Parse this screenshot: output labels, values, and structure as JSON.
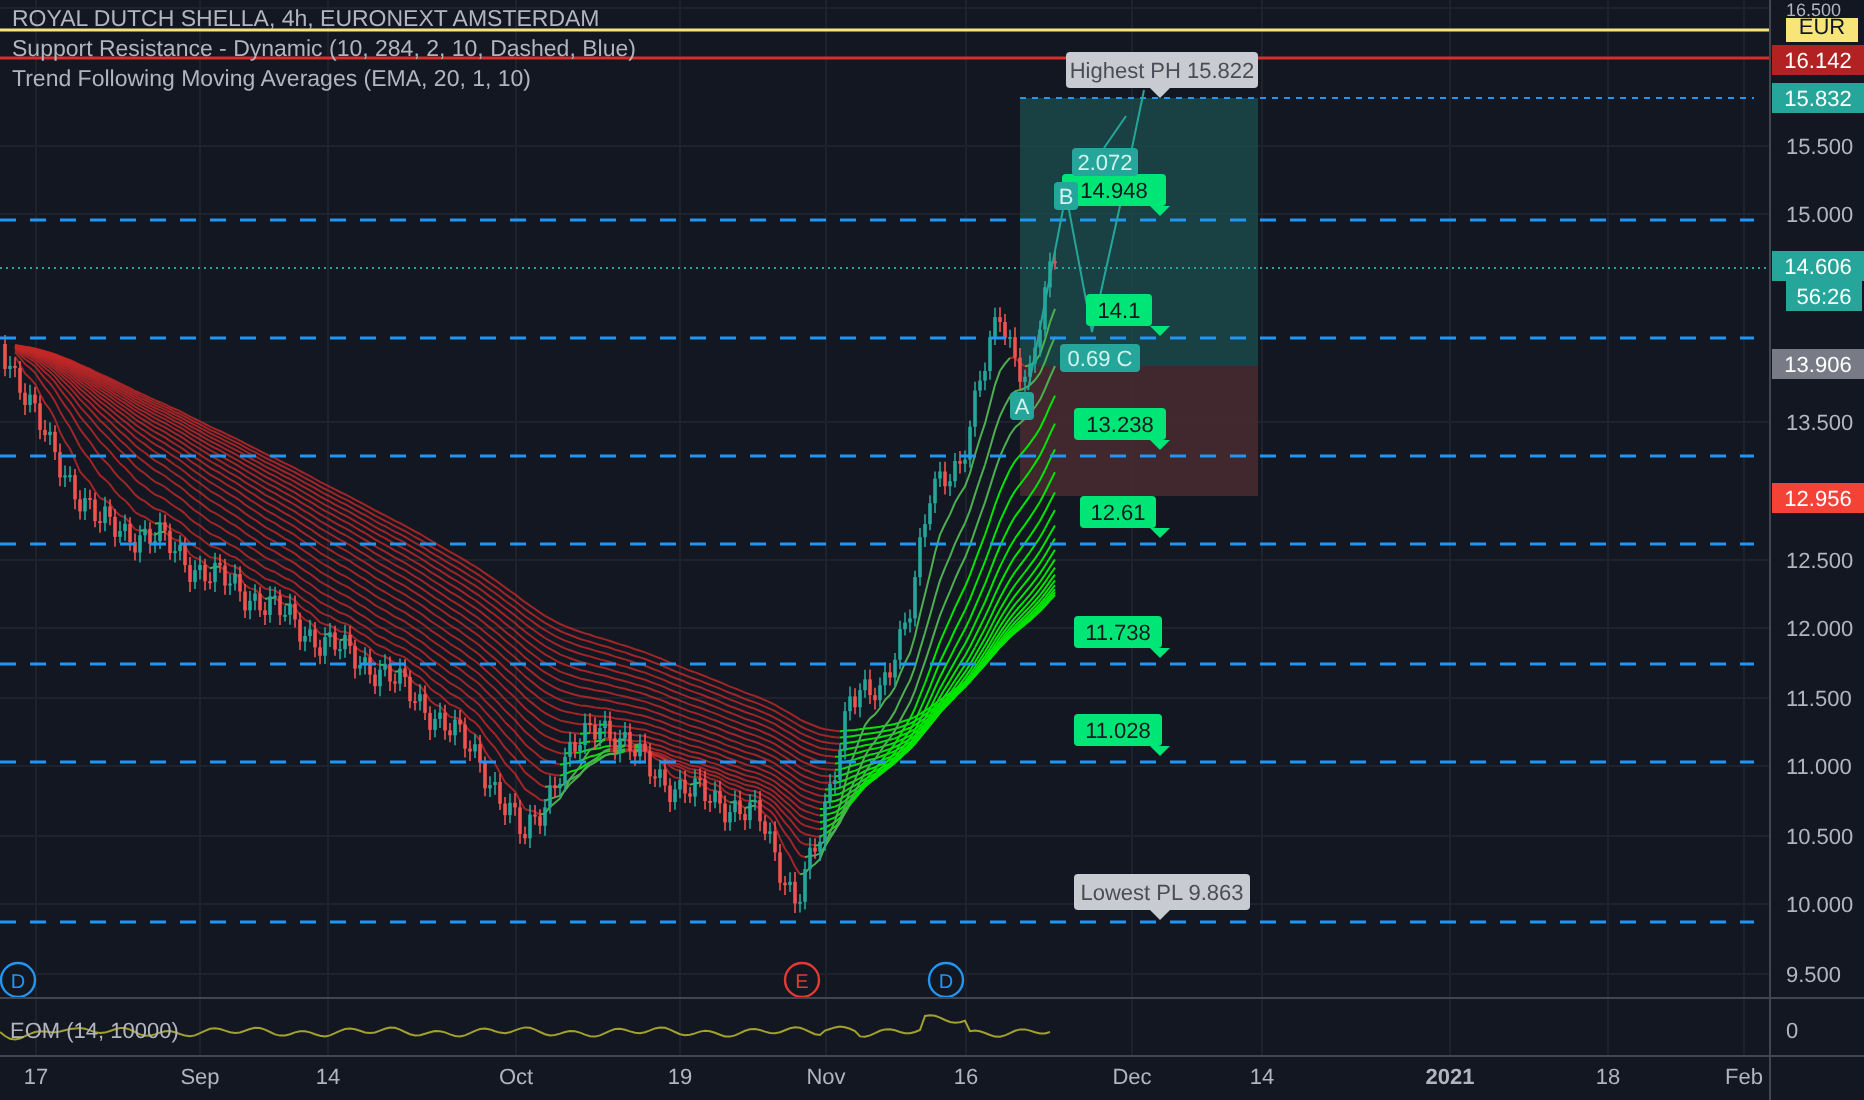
{
  "legend": [
    "ROYAL DUTCH SHELLA, 4h, EURONEXT AMSTERDAM",
    "Support Resistance - Dynamic (10, 284, 2, 10, Dashed, Blue)",
    "Trend Following Moving Averages (EMA, 20, 1, 10)"
  ],
  "price_axis": {
    "ticks": [
      "16.500",
      "15.500",
      "15.000",
      "13.500",
      "12.500",
      "12.000",
      "11.500",
      "11.000",
      "10.500",
      "10.000",
      "9.500"
    ],
    "badges": [
      {
        "text": "EUR",
        "color": "#f7e57a"
      },
      {
        "text": "16.142",
        "color": "#b22222"
      },
      {
        "text": "15.832",
        "color": "#26a69a"
      },
      {
        "text": "14.606",
        "color": "#26a69a"
      },
      {
        "text": "56:26",
        "color": "#26a69a"
      },
      {
        "text": "13.906",
        "color": "#787b86"
      },
      {
        "text": "12.956",
        "color": "#f44336"
      }
    ]
  },
  "time_axis": [
    {
      "label": "17",
      "bold": false
    },
    {
      "label": "Sep",
      "bold": false
    },
    {
      "label": "14",
      "bold": false
    },
    {
      "label": "Oct",
      "bold": false
    },
    {
      "label": "19",
      "bold": false
    },
    {
      "label": "Nov",
      "bold": false
    },
    {
      "label": "16",
      "bold": false
    },
    {
      "label": "Dec",
      "bold": false
    },
    {
      "label": "14",
      "bold": false
    },
    {
      "label": "2021",
      "bold": true
    },
    {
      "label": "18",
      "bold": false
    },
    {
      "label": "Feb",
      "bold": false
    }
  ],
  "pivots": {
    "high": "Highest PH 15.822",
    "low": "Lowest PL 9.863"
  },
  "levels": [
    {
      "label": "14.948"
    },
    {
      "label": "14.1"
    },
    {
      "label": "13.238"
    },
    {
      "label": "12.61"
    },
    {
      "label": "11.738"
    },
    {
      "label": "11.028"
    }
  ],
  "pattern_points": [
    {
      "label": "2.072"
    },
    {
      "label": "B"
    },
    {
      "label": "0.69 C"
    },
    {
      "label": "A"
    }
  ],
  "events": [
    {
      "letter": "D",
      "color": "#2196f3"
    },
    {
      "letter": "E",
      "color": "#e53935"
    },
    {
      "letter": "D",
      "color": "#2196f3"
    }
  ],
  "eom_pane": {
    "label": "EOM (14, 10000)",
    "zero_tick": "0"
  }
}
